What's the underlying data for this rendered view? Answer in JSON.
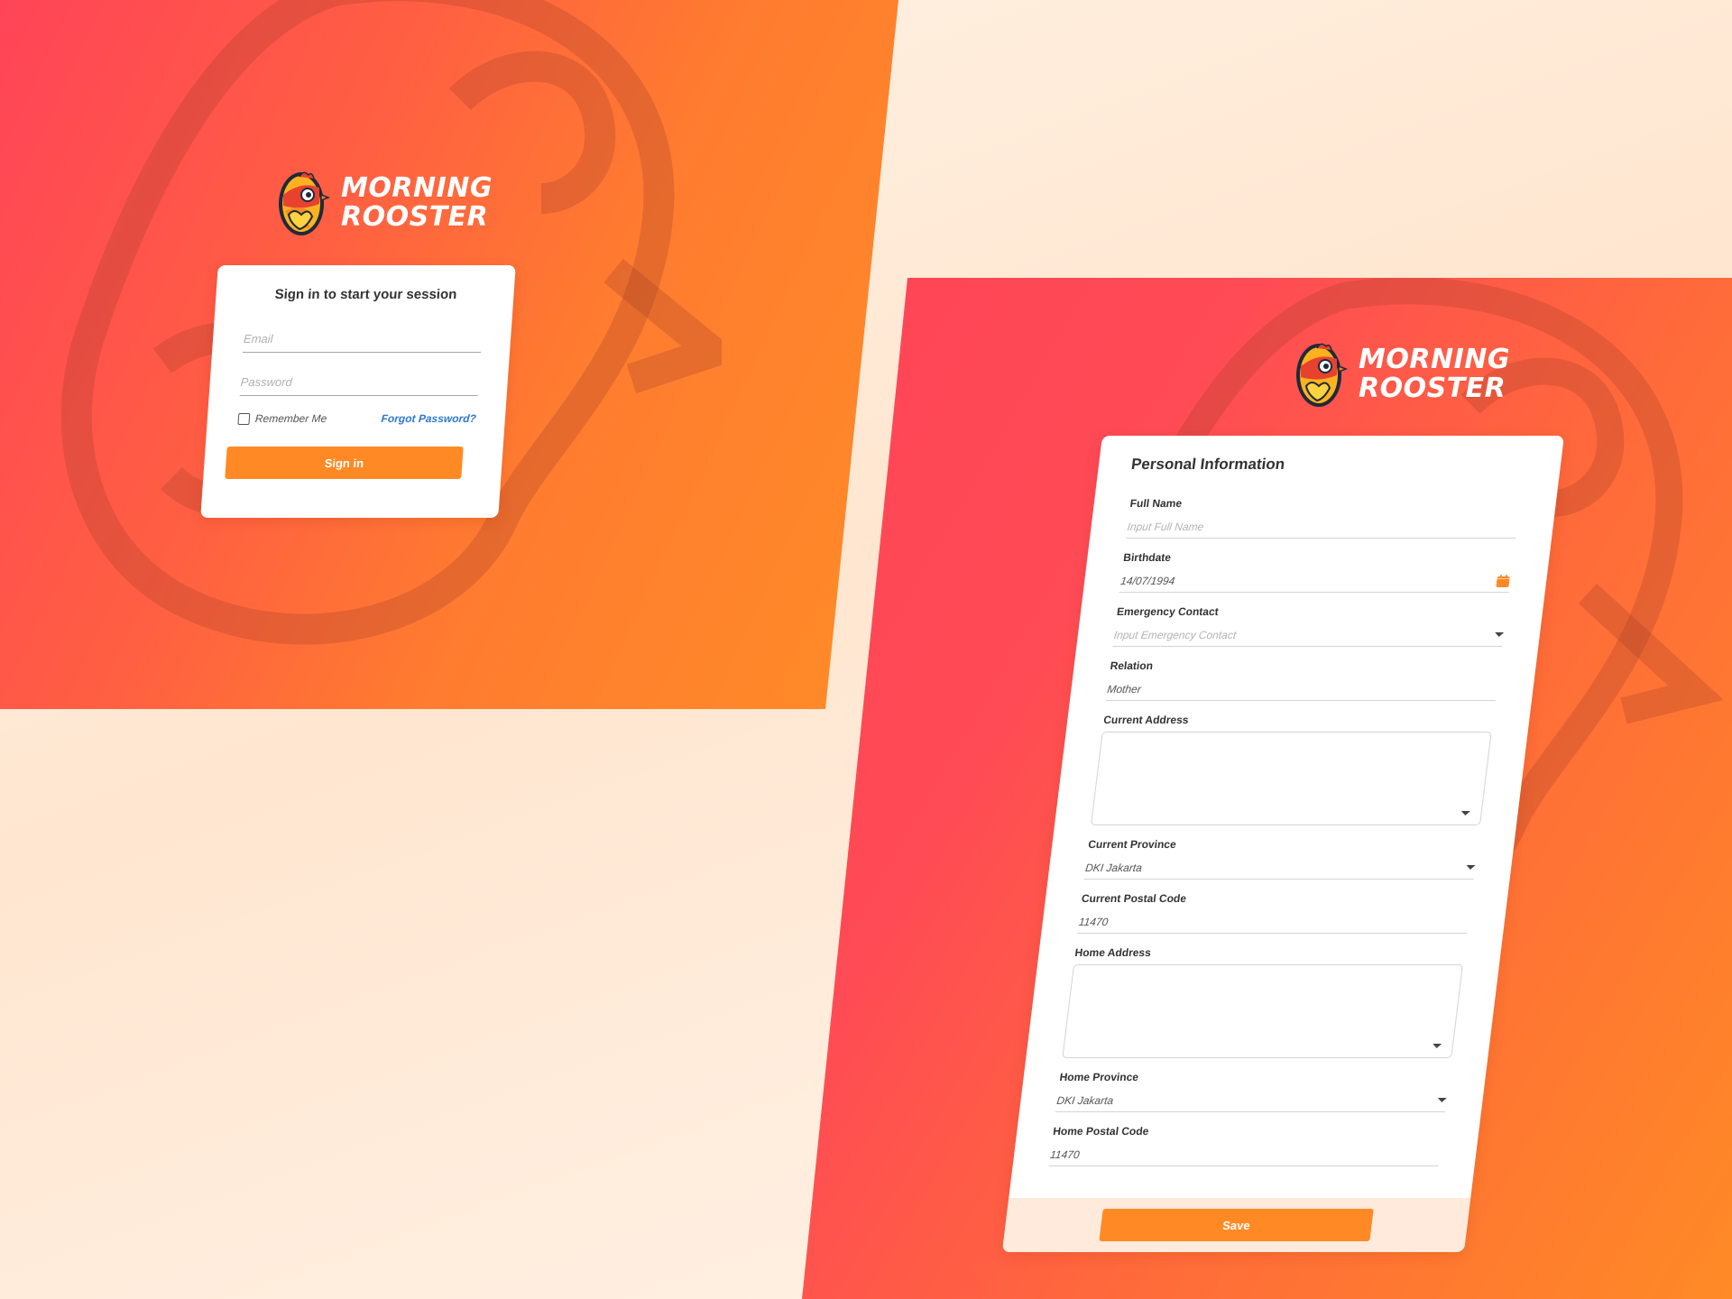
{
  "brand": {
    "name_line1": "MORNING",
    "name_line2": "ROOSTER",
    "colors": {
      "primary_orange": "#ff8a25",
      "primary_red": "#ff4458",
      "link_blue": "#2e78d2",
      "cream_background": "#ffeadb"
    }
  },
  "login": {
    "title": "Sign in to start your session",
    "email_placeholder": "Email",
    "password_placeholder": "Password",
    "remember_me_label": "Remember Me",
    "remember_me_checked": false,
    "forgot_password_label": "Forgot Password?",
    "signin_label": "Sign in"
  },
  "personal_info": {
    "title": "Personal Information",
    "fields": {
      "full_name": {
        "label": "Full Name",
        "placeholder": "Input Full Name",
        "value": ""
      },
      "birthdate": {
        "label": "Birthdate",
        "value": "14/07/1994",
        "icon": "calendar-icon"
      },
      "emergency_contact": {
        "label": "Emergency Contact",
        "placeholder": "Input Emergency Contact",
        "value": "",
        "icon": "chevron-down-icon"
      },
      "relation": {
        "label": "Relation",
        "value": "Mother"
      },
      "current_address": {
        "label": "Current Address",
        "value": ""
      },
      "current_province": {
        "label": "Current Province",
        "value": "DKI Jakarta",
        "icon": "chevron-down-icon"
      },
      "current_postal_code": {
        "label": "Current Postal Code",
        "value": "11470"
      },
      "home_address": {
        "label": "Home Address",
        "value": ""
      },
      "home_province": {
        "label": "Home Province",
        "value": "DKI Jakarta",
        "icon": "chevron-down-icon"
      },
      "home_postal_code": {
        "label": "Home Postal Code",
        "value": "11470"
      }
    },
    "save_label": "Save"
  }
}
